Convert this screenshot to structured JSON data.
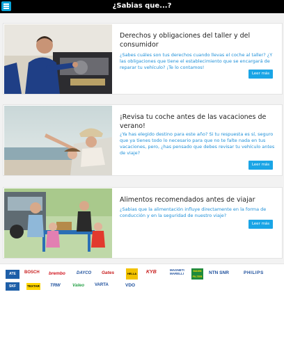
{
  "header": {
    "title": "¿Sabias que...?",
    "menu_icon": "hamburger-menu-icon"
  },
  "articles": [
    {
      "title": "Derechos y obligaciones del taller y del consumidor",
      "description": "¿Sabes cuáles son tus derechos cuando llevas el coche al taller? ¿Y las obligaciones que tiene el establecimiento que se encargará de reparar tu vehículo? ¡Te lo contamos!",
      "button": "Leer más"
    },
    {
      "title": "¡Revisa tu coche antes de las vacaciones de verano!",
      "description": "¿Ya has elegido destino para este año? Si tu respuesta es sí, seguro que ya tienes todo lo necesario para que no te falte nada en tus vacaciones, pero, ¿has pensado que debes revisar tu vehículo antes de viaje?",
      "button": "Leer más"
    },
    {
      "title": "Alimentos recomendados antes de viajar",
      "description": "¿Sabias que la alimentación influye directamente en la forma de conducción y en la seguridad de nuestro viaje?",
      "button": "Leer más"
    }
  ],
  "brands": {
    "row1": [
      "ATE",
      "BOSCH",
      "brembo",
      "DAYCO",
      "Gates",
      "HELLA",
      "KYB",
      "MAGNETI MARELLI",
      "MANN FILTER",
      "NTN SNR",
      "PHILIPS"
    ],
    "row2": [
      "SKF",
      "TEXTAR",
      "TRW",
      "Valeo",
      "VARTA",
      "VDO"
    ]
  }
}
